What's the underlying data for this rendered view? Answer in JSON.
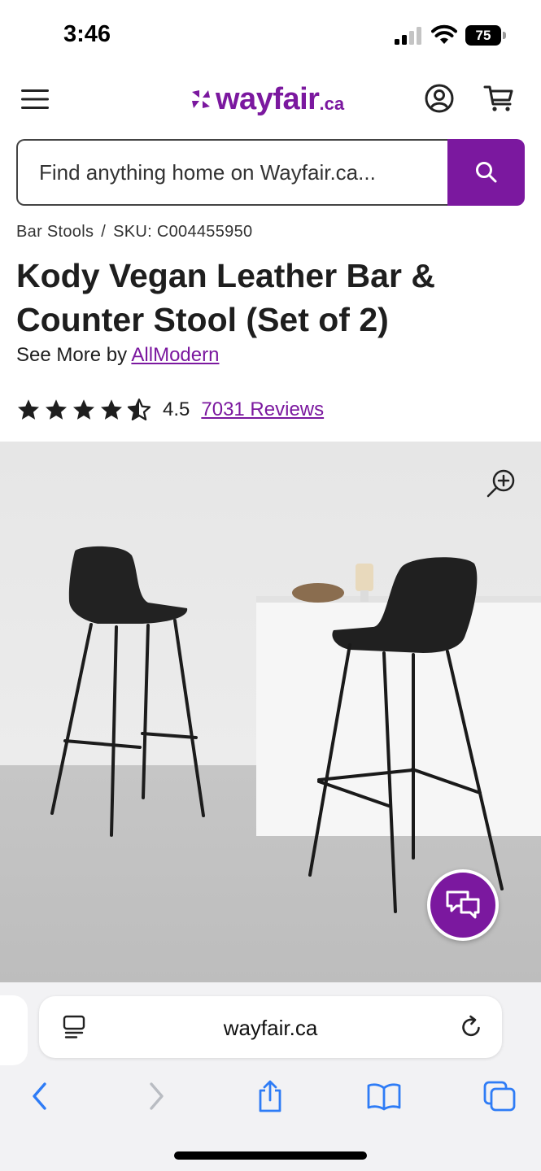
{
  "status_bar": {
    "time": "3:46",
    "battery_level": "75",
    "signal_bars_active": 2,
    "signal_bars_total": 4
  },
  "header": {
    "logo_text": "wayfair",
    "logo_suffix": ".ca",
    "brand_color": "#7b189f"
  },
  "search": {
    "placeholder": "Find anything home on Wayfair.ca..."
  },
  "breadcrumb": {
    "category": "Bar Stools",
    "separator": "/",
    "sku": "SKU: C004455950"
  },
  "product": {
    "title": "Kody Vegan Leather Bar & Counter Stool (Set of 2)",
    "see_more_prefix": "See More by",
    "brand": "AllModern",
    "rating": "4.5",
    "rating_max": 5,
    "reviews": "7031 Reviews"
  },
  "browser": {
    "address": "wayfair.ca"
  },
  "icons": {
    "menu": "hamburger-menu-icon",
    "account": "account-icon",
    "cart": "cart-icon",
    "search": "search-icon",
    "zoom": "zoom-in-icon",
    "chat": "chat-icon",
    "page_menu": "page-menu-icon",
    "reload": "reload-icon",
    "back": "back-chevron-icon",
    "forward": "forward-chevron-icon",
    "share": "share-icon",
    "bookmarks": "bookmarks-icon",
    "tabs": "tabs-icon"
  }
}
